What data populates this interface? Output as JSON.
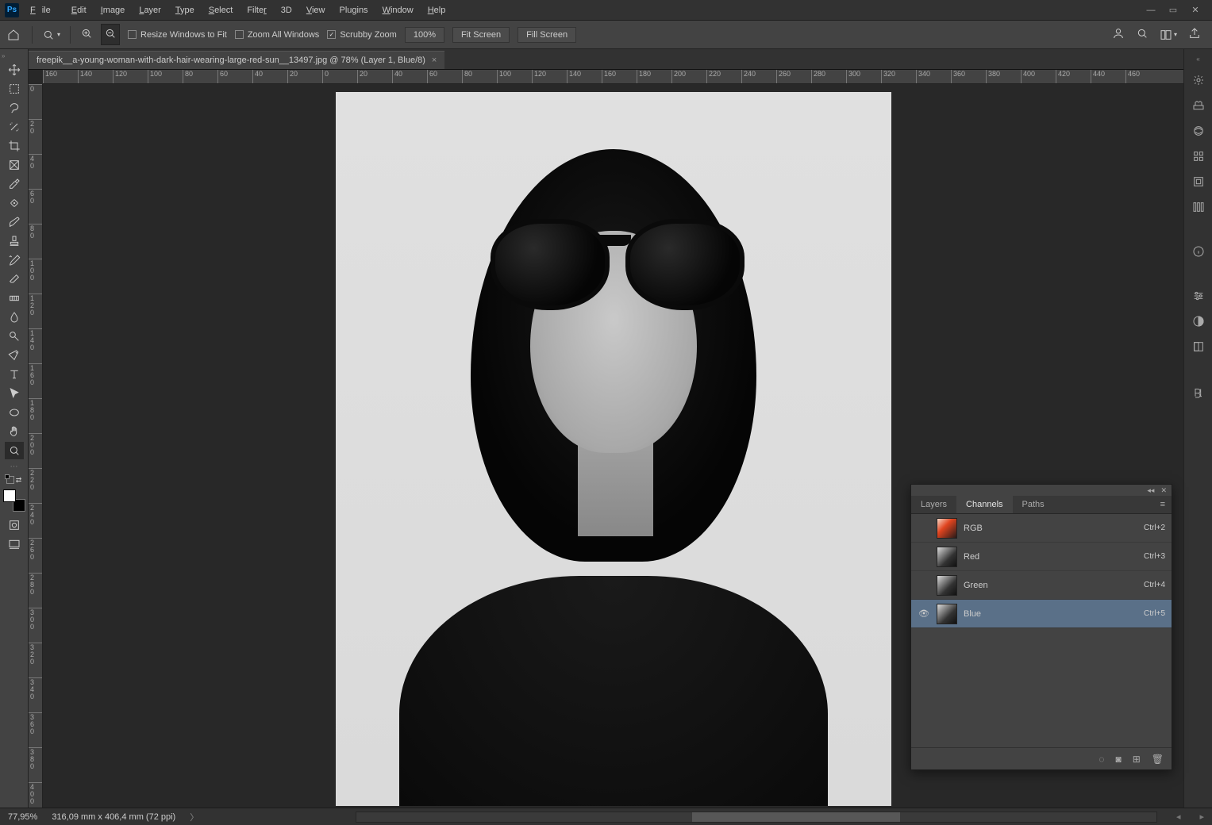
{
  "menu": {
    "file": "File",
    "edit": "Edit",
    "image": "Image",
    "layer": "Layer",
    "type": "Type",
    "select": "Select",
    "filter": "Filter",
    "threeD": "3D",
    "view": "View",
    "plugins": "Plugins",
    "window": "Window",
    "help": "Help"
  },
  "options": {
    "resize_windows": "Resize Windows to Fit",
    "zoom_all": "Zoom All Windows",
    "scrubby": "Scrubby Zoom",
    "pct": "100%",
    "fit": "Fit Screen",
    "fill": "Fill Screen"
  },
  "document": {
    "tab_title": "freepik__a-young-woman-with-dark-hair-wearing-large-red-sun__13497.jpg @ 78% (Layer 1, Blue/8)"
  },
  "ruler_h": [
    "160",
    "140",
    "120",
    "100",
    "80",
    "60",
    "40",
    "20",
    "0",
    "20",
    "40",
    "60",
    "80",
    "100",
    "120",
    "140",
    "160",
    "180",
    "200",
    "220",
    "240",
    "260",
    "280",
    "300",
    "320",
    "340",
    "360",
    "380",
    "400",
    "420",
    "440",
    "460"
  ],
  "ruler_v": [
    "0",
    "20",
    "40",
    "60",
    "80",
    "100",
    "120",
    "140",
    "160",
    "180",
    "200",
    "220",
    "240",
    "260",
    "280",
    "300",
    "320",
    "340",
    "360",
    "380",
    "400"
  ],
  "status": {
    "zoom": "77,95%",
    "dims": "316,09 mm x 406,4 mm (72 ppi)"
  },
  "panel": {
    "tabs": {
      "layers": "Layers",
      "channels": "Channels",
      "paths": "Paths"
    },
    "channels": [
      {
        "name": "RGB",
        "shortcut": "Ctrl+2",
        "visible": false,
        "selected": false,
        "rgb": true
      },
      {
        "name": "Red",
        "shortcut": "Ctrl+3",
        "visible": false,
        "selected": false,
        "rgb": false
      },
      {
        "name": "Green",
        "shortcut": "Ctrl+4",
        "visible": false,
        "selected": false,
        "rgb": false
      },
      {
        "name": "Blue",
        "shortcut": "Ctrl+5",
        "visible": true,
        "selected": true,
        "rgb": false
      }
    ]
  }
}
